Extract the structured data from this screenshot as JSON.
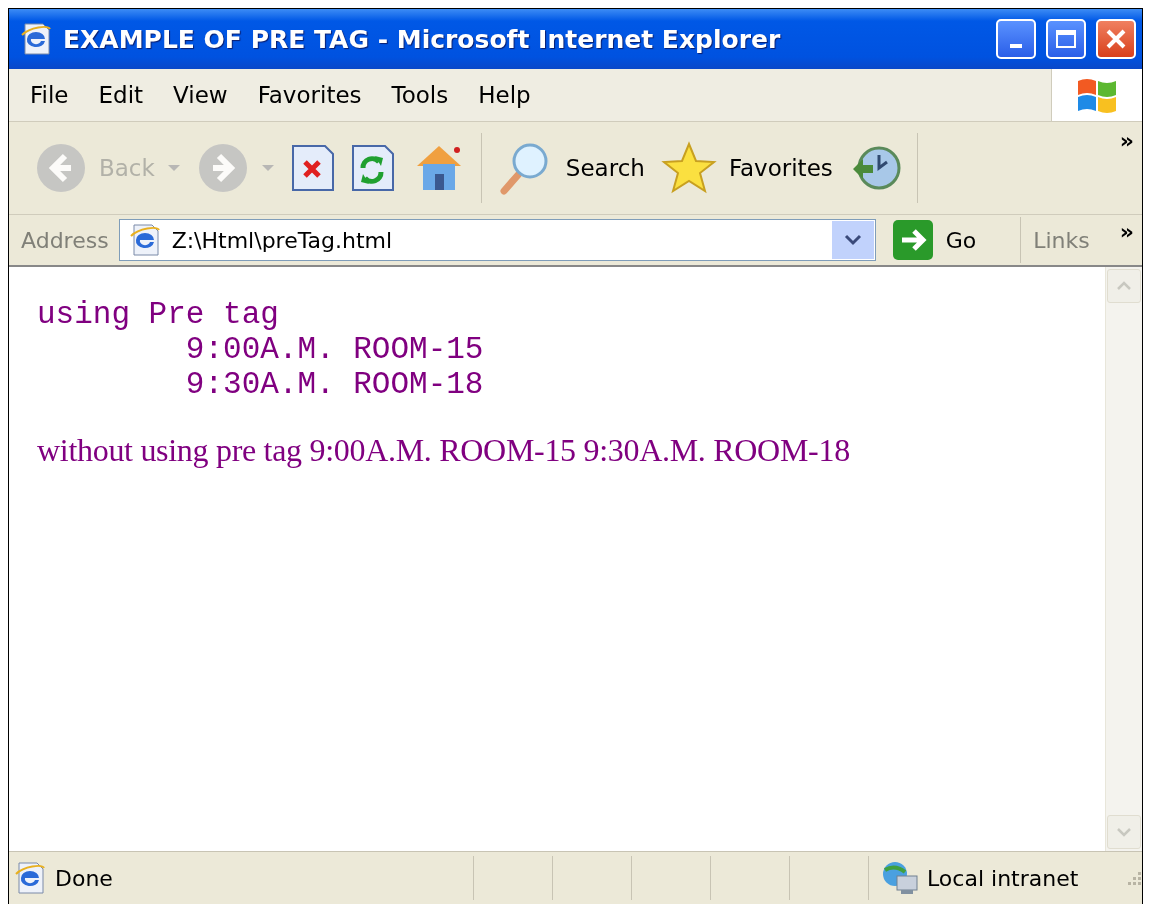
{
  "window": {
    "title": "EXAMPLE OF PRE TAG - Microsoft Internet Explorer"
  },
  "menu": [
    "File",
    "Edit",
    "View",
    "Favorites",
    "Tools",
    "Help"
  ],
  "toolbar": {
    "items": [
      {
        "kind": "back",
        "label": "Back",
        "disabled": true,
        "dropdown": true
      },
      {
        "kind": "forward",
        "disabled": true,
        "dropdown": true
      },
      {
        "kind": "stop",
        "disabled": false,
        "dropdown": false
      },
      {
        "kind": "refresh",
        "disabled": false,
        "dropdown": false
      },
      {
        "kind": "home",
        "disabled": false,
        "dropdown": false
      },
      {
        "kind": "search",
        "label": "Search",
        "disabled": false,
        "dropdown": false
      },
      {
        "kind": "favorites",
        "label": "Favorites",
        "disabled": false,
        "dropdown": false
      },
      {
        "kind": "history",
        "disabled": false,
        "dropdown": false
      }
    ],
    "overflow": "»"
  },
  "address": {
    "label": "Address",
    "value": "Z:\\Html\\preTag.html",
    "go": "Go",
    "links": "Links",
    "links_overflow": "»"
  },
  "content": {
    "pre_text": "using Pre tag\n\t9:00A.M. ROOM-15\n\t9:30A.M. ROOM-18",
    "paragraph": "without using pre tag 9:00A.M. ROOM-15 9:30A.M. ROOM-18"
  },
  "status_bar": {
    "text": "Done",
    "zone": "Local intranet"
  }
}
